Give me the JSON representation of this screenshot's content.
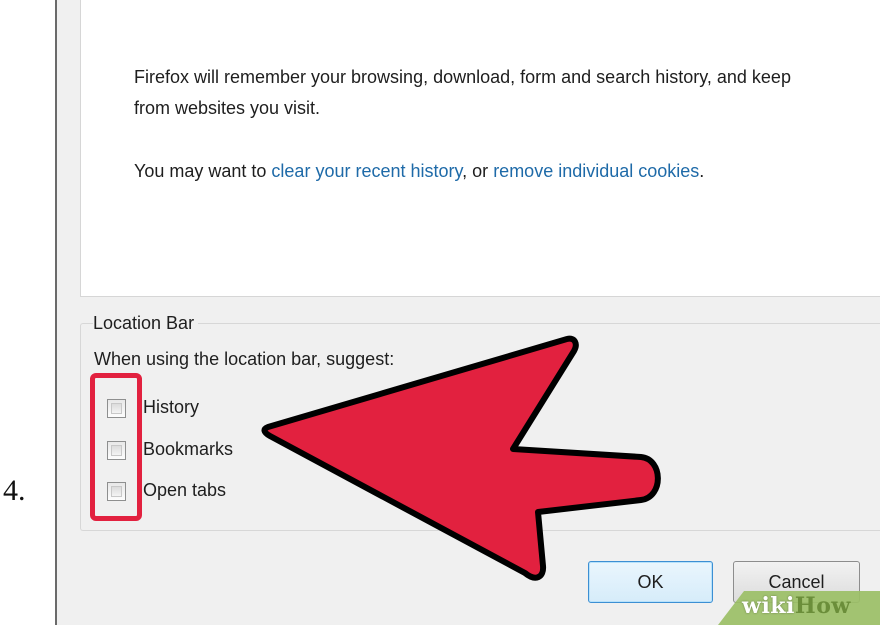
{
  "step_number": "4.",
  "history_panel": {
    "line1": "Firefox will remember your browsing, download, form and search history, and keep",
    "line2": "from websites you visit.",
    "cookies_prefix": "You may want to ",
    "clear_history_link": "clear your recent history",
    "cookies_middle": ", or ",
    "remove_cookies_link": "remove individual cookies",
    "cookies_suffix": "."
  },
  "location_bar": {
    "legend": "Location Bar",
    "suggest_label": "When using the location bar, suggest:",
    "checkboxes": [
      {
        "label": "History",
        "checked": false
      },
      {
        "label": "Bookmarks",
        "checked": false
      },
      {
        "label": "Open tabs",
        "checked": false
      }
    ]
  },
  "buttons": {
    "ok": "OK",
    "cancel": "Cancel"
  },
  "annotation": {
    "arrow_color": "#e2213f",
    "highlight_color": "#e2213f"
  },
  "watermark": {
    "wiki": "wiki",
    "how": "How"
  }
}
